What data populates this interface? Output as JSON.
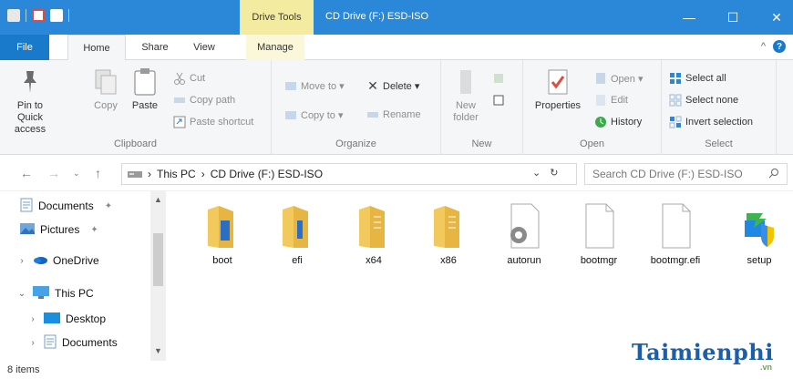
{
  "window": {
    "title": "CD Drive (F:) ESD-ISO",
    "context_tab": "Drive Tools",
    "controls": {
      "minimize": "—",
      "maximize": "☐",
      "close": "✕"
    }
  },
  "tabs": [
    {
      "label": "File"
    },
    {
      "label": "Home"
    },
    {
      "label": "Share"
    },
    {
      "label": "View"
    },
    {
      "label": "Manage"
    }
  ],
  "ribbon_controls": {
    "collapse": "^",
    "help": "?"
  },
  "ribbon": {
    "clipboard": {
      "label": "Clipboard",
      "pin_to_quick_access": "Pin to Quick access",
      "copy": "Copy",
      "paste": "Paste",
      "cut": "Cut",
      "copy_path": "Copy path",
      "paste_shortcut": "Paste shortcut"
    },
    "organize": {
      "label": "Organize",
      "move_to": "Move to ▾",
      "copy_to": "Copy to ▾",
      "delete": "Delete ▾",
      "rename": "Rename"
    },
    "new": {
      "label": "New",
      "new_folder": "New folder"
    },
    "open": {
      "label": "Open",
      "properties": "Properties",
      "open": "Open ▾",
      "edit": "Edit",
      "history": "History"
    },
    "select": {
      "label": "Select",
      "select_all": "Select all",
      "select_none": "Select none",
      "invert_selection": "Invert selection"
    }
  },
  "address": {
    "this_pc": "This PC",
    "drive": "CD Drive (F:) ESD-ISO",
    "search_placeholder": "Search CD Drive (F:) ESD-ISO"
  },
  "nav": {
    "items": [
      {
        "label": "Documents"
      },
      {
        "label": "Pictures"
      },
      {
        "label": "OneDrive"
      },
      {
        "label": "This PC"
      },
      {
        "label": "Desktop"
      },
      {
        "label": "Documents"
      }
    ]
  },
  "files": [
    {
      "name": "boot",
      "type": "folder"
    },
    {
      "name": "efi",
      "type": "folder"
    },
    {
      "name": "x64",
      "type": "folder"
    },
    {
      "name": "x86",
      "type": "folder"
    },
    {
      "name": "autorun",
      "type": "settings-file"
    },
    {
      "name": "bootmgr",
      "type": "file"
    },
    {
      "name": "bootmgr.efi",
      "type": "file"
    },
    {
      "name": "setup",
      "type": "setup"
    }
  ],
  "status": {
    "items": "8 items"
  },
  "watermark": {
    "brand": "Taimienphi",
    "suffix": ".vn"
  },
  "colors": {
    "titlebar": "#2b87d8",
    "file_tab": "#1979ca",
    "drive_tools": "#f3eb9f",
    "folder": "#f2c95c"
  }
}
